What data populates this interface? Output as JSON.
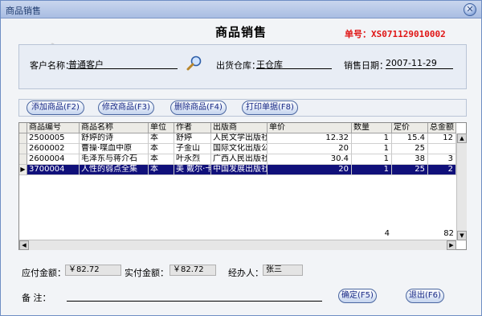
{
  "window": {
    "title": "商品销售",
    "close_glyph": "✕"
  },
  "header": {
    "title": "商品销售",
    "order_no": "单号：XS071129010002"
  },
  "form": {
    "customer_label": "客户名称：",
    "customer_value": "普通客户",
    "warehouse_label": "出货仓库：",
    "warehouse_value": "王仓库",
    "date_label": "销售日期：",
    "date_value": "2007-11-29"
  },
  "toolbar": {
    "add": "添加商品(F2)",
    "edit": "修改商品(F3)",
    "delete": "删除商品(F4)",
    "print": "打印单据(F8)"
  },
  "table": {
    "columns": [
      "商品编号",
      "商品名称",
      "单位",
      "作者",
      "出版商",
      "单价",
      "数量",
      "定价",
      "总金额"
    ],
    "rows": [
      [
        "2500005",
        "舒婷的诗",
        "本",
        "舒婷",
        "人民文学出版社",
        "12.32",
        "1",
        "15.4",
        "12"
      ],
      [
        "2600002",
        "曹操·喋血中原",
        "本",
        "子金山",
        "国际文化出版公",
        "20",
        "1",
        "25",
        ""
      ],
      [
        "2600004",
        "毛泽东与蒋介石",
        "本",
        "叶永烈",
        "广西人民出版社",
        "30.4",
        "1",
        "38",
        "3"
      ],
      [
        "3700004",
        "人性的弱点全集",
        "本",
        "美 戴尔·卡",
        "中国发展出版社",
        "20",
        "1",
        "25",
        "2"
      ]
    ],
    "selected_row": 3,
    "selected_marker": "▶",
    "totals": {
      "qty": "4",
      "amount": "82"
    }
  },
  "footer": {
    "payable_label": "应付金额：",
    "payable_value": "￥82.72",
    "paid_label": "实付金额：",
    "paid_value": "￥82.72",
    "handler_label": "经办人：",
    "handler_value": "张三",
    "memo_label": "备    注：",
    "confirm": "确定(F5)",
    "exit": "退出(F6)"
  },
  "colors": {
    "order_no": "#e01515",
    "selection": "#10107a",
    "button_text": "#1a2a86"
  }
}
